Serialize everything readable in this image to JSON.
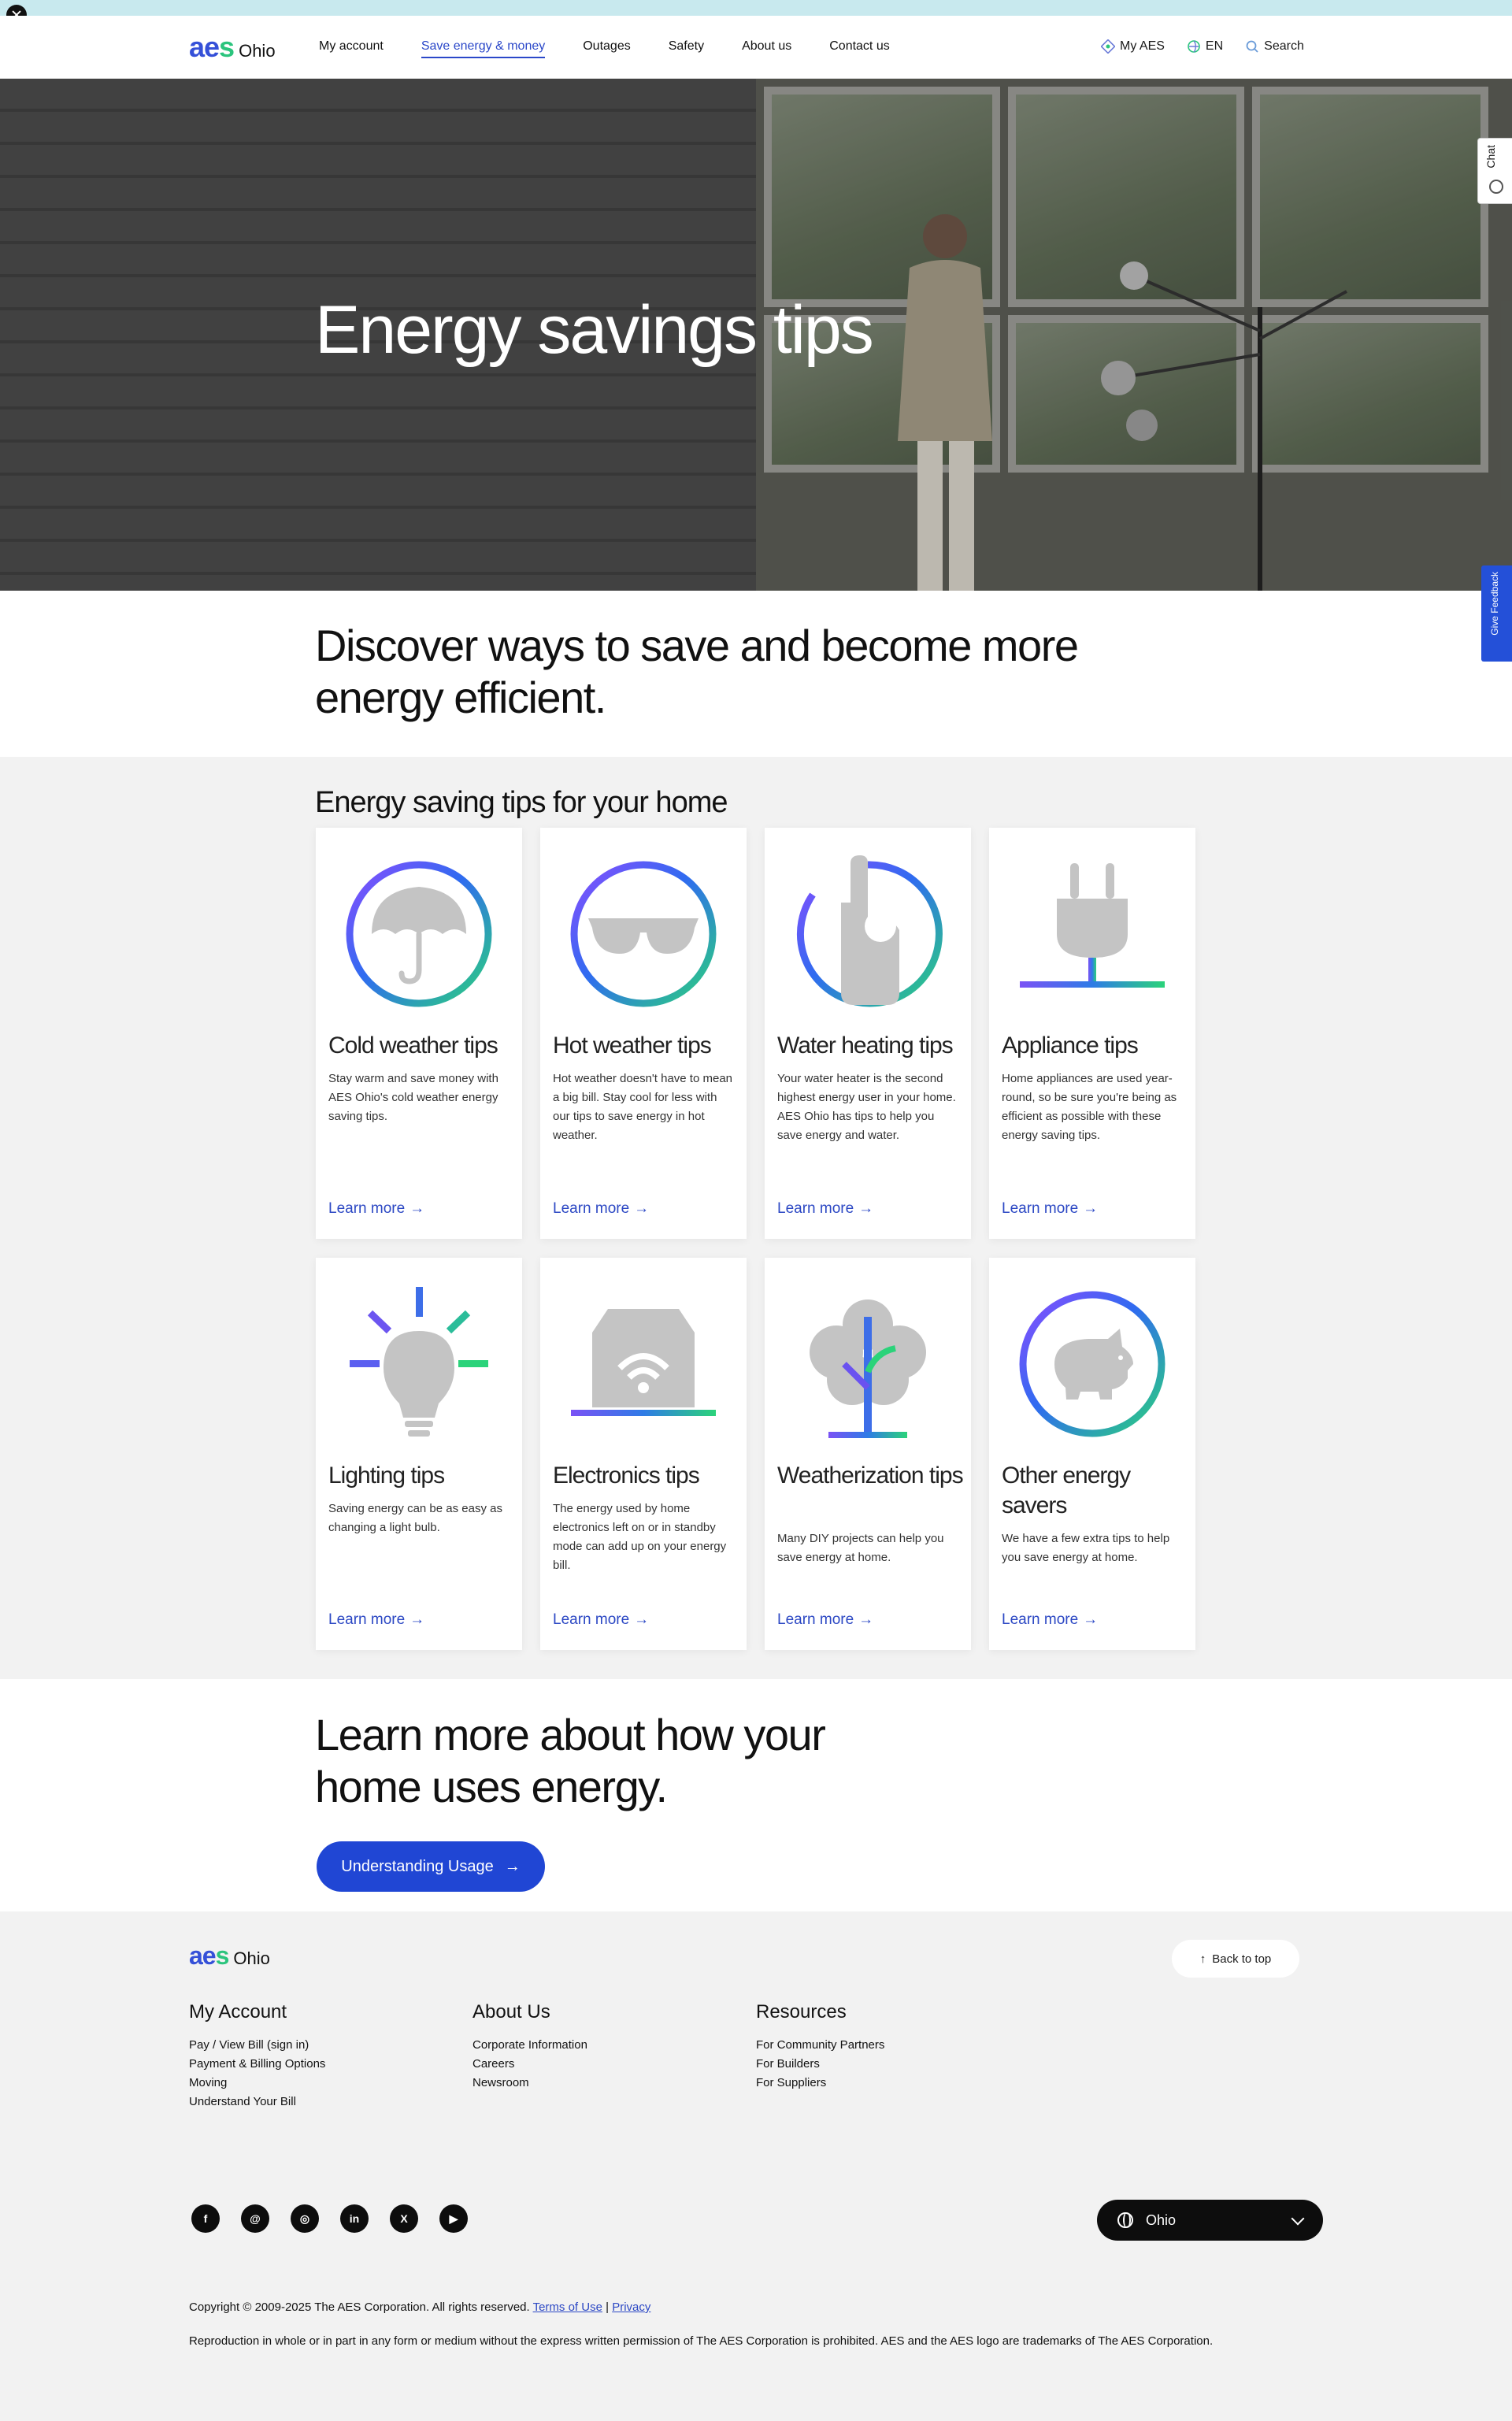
{
  "header": {
    "logo_word": "aes",
    "logo_region": "Ohio",
    "nav": [
      "My account",
      "Save energy & money",
      "Outages",
      "Safety",
      "About us",
      "Contact us"
    ],
    "active_nav": "Save energy & money",
    "utilities": {
      "my_aes": "My AES",
      "language": "EN",
      "search": "Search"
    }
  },
  "hero": {
    "title": "Energy savings tips"
  },
  "side_tabs": {
    "chat": "Chat",
    "feedback": "Give Feedback"
  },
  "intro": {
    "text": "Discover ways to save and become more energy efficient."
  },
  "tips": {
    "title": "Energy saving tips for your home",
    "link_label": "Learn more",
    "cards": [
      {
        "title": "Cold weather tips",
        "desc": "Stay warm and save money with AES Ohio's cold weather energy saving tips.",
        "icon": "umbrella-icon"
      },
      {
        "title": "Hot weather tips",
        "desc": "Hot weather doesn't have to mean a big bill. Stay cool for less with our tips to save energy in hot weather.",
        "icon": "sunglasses-icon"
      },
      {
        "title": "Water heating tips",
        "desc": "Your water heater is the second highest energy user in your home. AES Ohio has tips to help you save energy and water.",
        "icon": "hand-icon"
      },
      {
        "title": "Appliance tips",
        "desc": "Home appliances are used year-round, so be sure you're being as efficient as possible with these energy saving tips.",
        "icon": "plug-icon"
      },
      {
        "title": "Lighting tips",
        "desc": "Saving energy can be as easy as changing a light bulb.",
        "icon": "lightbulb-icon"
      },
      {
        "title": "Electronics tips",
        "desc": "The energy used by home electronics left on or in standby mode can add up on your energy bill.",
        "icon": "house-wifi-icon"
      },
      {
        "title": "Weatherization tips",
        "desc": "Many DIY projects can help you save energy at home.",
        "icon": "tree-icon"
      },
      {
        "title": "Other energy savers",
        "desc": "We have a few extra tips to help you save energy at home.",
        "icon": "piggy-bank-icon"
      }
    ]
  },
  "learn_more": {
    "title": "Learn more about how your home uses energy.",
    "button": "Understanding Usage"
  },
  "footer": {
    "logo_word": "aes",
    "logo_region": "Ohio",
    "back_to_top": "Back to top",
    "columns": [
      {
        "heading": "My Account",
        "links": [
          "Pay / View Bill (sign in)",
          "Payment & Billing Options",
          "Moving",
          "Understand Your Bill"
        ]
      },
      {
        "heading": "About Us",
        "links": [
          "Corporate Information",
          "Careers",
          "Newsroom"
        ]
      },
      {
        "heading": "Resources",
        "links": [
          "For Community Partners",
          "For Builders",
          "For Suppliers"
        ]
      }
    ],
    "social": [
      "facebook-icon",
      "threads-icon",
      "instagram-icon",
      "linkedin-icon",
      "x-icon",
      "youtube-icon"
    ],
    "region": "Ohio",
    "copyright": "Copyright © 2009-2025 The AES Corporation. All rights reserved.",
    "terms": "Terms of Use",
    "separator": "|",
    "privacy": "Privacy",
    "disclaimer": "Reproduction in whole or in part in any form or medium without the express written permission of The AES Corporation is prohibited. AES and the AES logo are trademarks of The AES Corporation."
  },
  "colors": {
    "brand_blue": "#2046d4",
    "link_blue": "#2c48c4",
    "brand_green": "#2bc47d",
    "banner": "#c8e9ee"
  }
}
